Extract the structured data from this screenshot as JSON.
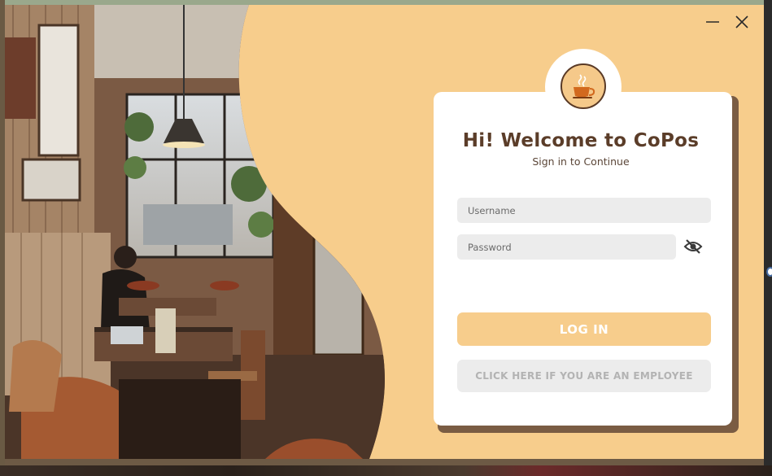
{
  "window": {
    "minimize_icon": "minimize-icon",
    "close_icon": "close-icon"
  },
  "brand": {
    "logo_icon": "coffee-cup-icon"
  },
  "login": {
    "title": "Hi! Welcome to CoPos",
    "subtitle": "Sign in to Continue",
    "username_placeholder": "Username",
    "password_placeholder": "Password",
    "password_toggle_icon": "eye-off-icon",
    "login_button": "LOG IN",
    "employee_button": "CLICK HERE IF YOU ARE AN EMPLOYEE"
  },
  "colors": {
    "accent": "#f7cd8c",
    "brand_brown": "#5b3d29",
    "field_bg": "#ececec",
    "employee_text": "#b3b3b3"
  }
}
